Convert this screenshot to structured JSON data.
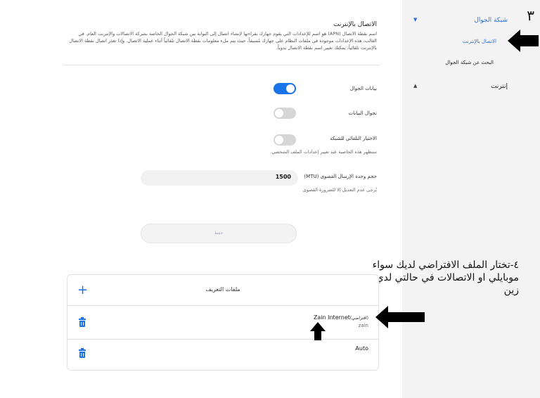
{
  "sidebar": {
    "step_number": "٣",
    "mobile_network": "شبكة الجوال",
    "internet_connection": "الاتصال بالإنترنت",
    "search_mobile_network": "البحث عن شبكة الجوال",
    "internet": "إنترنت",
    "expand_icon": "triangle-down",
    "collapse_icon": "triangle-up"
  },
  "main": {
    "title": "الاتصال بالإنترنت",
    "description": "اسم نقطة الاتصال (APN) هو اسم للإعدادات التي يقوم جهازك بقراءتها لإنشاء اتصال إلى البوابة بين شبكة الجوال الخاصة بشركة الاتصالات والإنترنت العام. في الغالب، هذه الإعدادات موجودة في ملفات النظام على جهازك مُسبقاً، حيث يتم ملء معلومات نقطة الاتصال تلقائياً أثناء عملية الاتصال. وإذا تعذر اتصال نقطة الاتصال بالإنترنت تلقائياً، يمكنك تغيير اسم نقطة الاتصال يدوياً.",
    "mobile_data_label": "بيانات الجوال",
    "mobile_data_on": true,
    "data_roaming_label": "تجوال البيانات",
    "data_roaming_on": false,
    "auto_network_label": "الاختيار التلقائي للشبكة",
    "auto_network_on": false,
    "auto_network_note": "ستظهر هذه الخاصية عند تغيير إعدادات الملف الشخصي.",
    "mtu_label": "حجم وحدة الإرسال القصوى (MTU)",
    "mtu_value": "1500",
    "mtu_note": "يُرجى عدم التعديل إلا للضرورة القصوى",
    "save_label": "حفظ",
    "accent_color": "#1a73e8"
  },
  "profiles": {
    "title": "ملفات التعريف",
    "add_icon": "plus",
    "delete_icon": "trash",
    "items": [
      {
        "name": "Zain Internet",
        "default_tag": "(افتراضي)",
        "sub": "zain"
      },
      {
        "name": "Auto",
        "default_tag": "",
        "sub": ""
      }
    ]
  },
  "annotation": {
    "text": "٤-تختار الملف الافتراضي لديك سواء موبايلي او الاتصالات في حالتي لدي زين"
  }
}
